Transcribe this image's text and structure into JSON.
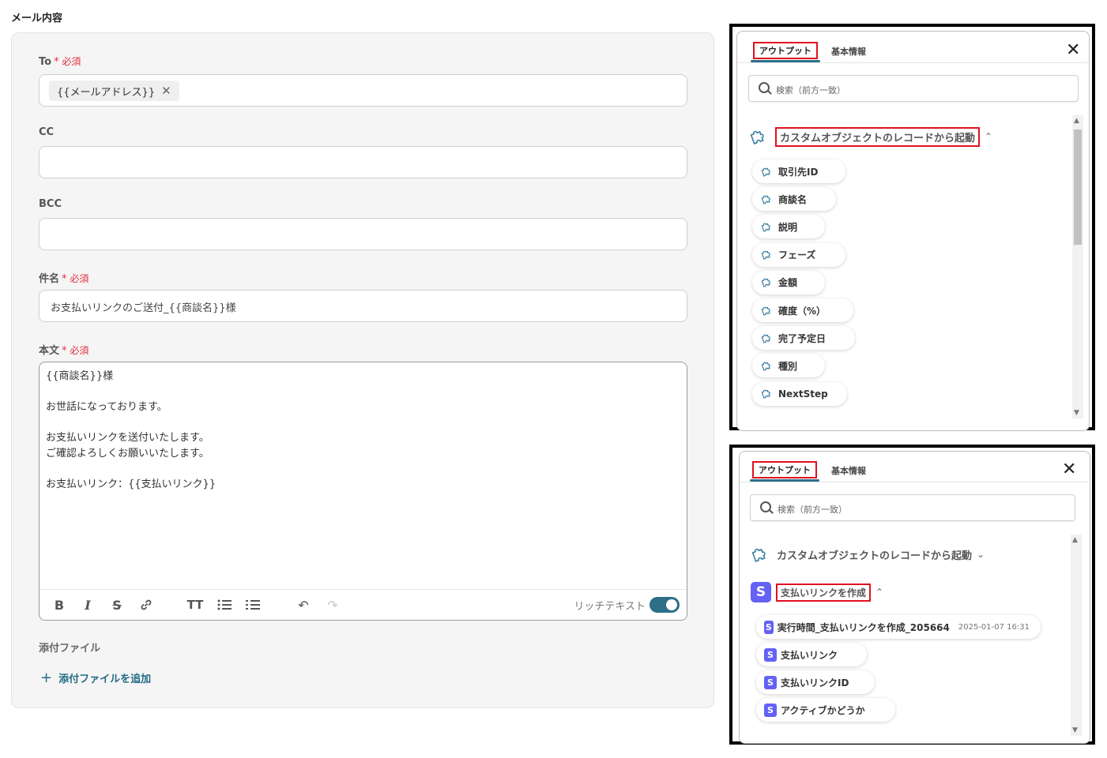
{
  "form": {
    "section_title": "メール内容",
    "to": {
      "label": "To",
      "required": "必須",
      "chip": "{{メールアドレス}}"
    },
    "cc": {
      "label": "CC",
      "value": ""
    },
    "bcc": {
      "label": "BCC",
      "value": ""
    },
    "subject": {
      "label": "件名",
      "required": "必須",
      "value": "お支払いリンクのご送付_{{商談名}}様"
    },
    "body": {
      "label": "本文",
      "required": "必須",
      "lines": [
        "{{商談名}}様",
        "",
        "お世話になっております。",
        "",
        "お支払いリンクを送付いたします。",
        "ご確認よろしくお願いいたします。",
        "",
        "お支払いリンク：{{支払いリンク}}"
      ],
      "rich_text_label": "リッチテキスト",
      "rich_text_on": true
    },
    "attachment": {
      "label": "添付ファイル",
      "add_label": "添付ファイルを追加"
    }
  },
  "panel_top": {
    "tabs": [
      "アウトプット",
      "基本情報"
    ],
    "active_tab": "アウトプット",
    "search_placeholder": "検索（前方一致）",
    "group_title": "カスタムオブジェクトのレコードから起動",
    "items": [
      "取引先ID",
      "商談名",
      "説明",
      "フェーズ",
      "金額",
      "確度（%）",
      "完了予定日",
      "種別",
      "NextStep"
    ]
  },
  "panel_bottom": {
    "tabs": [
      "アウトプット",
      "基本情報"
    ],
    "active_tab": "アウトプット",
    "search_placeholder": "検索（前方一致）",
    "group_collapsed": "カスタムオブジェクトのレコードから起動",
    "group_title": "支払いリンクを作成",
    "group_icon_letter": "S",
    "items": [
      {
        "label": "実行時間_支払いリンクを作成_205664",
        "timestamp": "2025-01-07 16:31"
      },
      {
        "label": "支払いリンク"
      },
      {
        "label": "支払いリンクID"
      },
      {
        "label": "アクティブかどうか"
      }
    ]
  },
  "colors": {
    "accent": "#2d6f88",
    "required": "#e0303f",
    "highlight": "#e0111f",
    "stripe": "#6461f5"
  },
  "icons": [
    "bold-icon",
    "italic-icon",
    "strikethrough-icon",
    "link-icon",
    "text-size-icon",
    "bullet-list-icon",
    "numbered-list-icon",
    "undo-icon",
    "redo-icon",
    "plus-icon",
    "close-icon",
    "search-icon",
    "puzzle-icon",
    "stripe-icon",
    "chevron-up-icon",
    "chevron-down-icon"
  ]
}
